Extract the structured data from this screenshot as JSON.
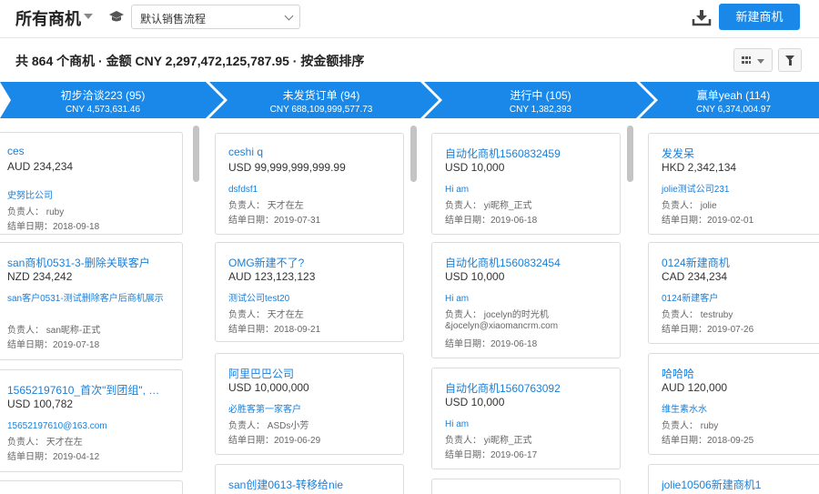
{
  "header": {
    "title": "所有商机",
    "pipeline": "默认销售流程",
    "new_button": "新建商机"
  },
  "summary": "共 864 个商机 · 金额 CNY 2,297,472,125,787.95 · 按金额排序",
  "stages": [
    {
      "name": "初步洽谈223 (95)",
      "amount": "CNY 4,573,631.46"
    },
    {
      "name": "未发货订单 (94)",
      "amount": "CNY 688,109,999,577.73"
    },
    {
      "name": "进行中 (105)",
      "amount": "CNY 1,382,393"
    },
    {
      "name": "赢单yeah (114)",
      "amount": "CNY 6,374,004.97"
    }
  ],
  "columns": [
    {
      "cards": [
        {
          "title": "ces",
          "amount": "AUD 234,234",
          "customer": "史努比公司",
          "owner": "负责人：  ruby",
          "date": "结单日期：2018-09-18"
        },
        {
          "title": "san商机0531-3-删除关联客户",
          "amount": "NZD 234,242",
          "customer": "san客户0531-测试删除客户后商机展示",
          "owner": "负责人：  san昵称-正式",
          "date": "结单日期：2019-07-18"
        },
        {
          "title": "15652197610_首次\"到团组\", …",
          "amount": "USD 100,782",
          "customer": "15652197610@163.com",
          "owner": "负责人：  天才在左",
          "date": "结单日期：2019-04-12"
        }
      ]
    },
    {
      "cards": [
        {
          "title": "ceshi q",
          "amount": "USD 99,999,999,999.99",
          "customer": "dsfdsf1",
          "owner": "负责人：  天才在左",
          "date": "结单日期：2019-07-31"
        },
        {
          "title": "OMG新建不了?",
          "amount": "AUD 123,123,123",
          "customer": "测试公司test20",
          "owner": "负责人：  天才在左",
          "date": "结单日期：2018-09-21"
        },
        {
          "title": "阿里巴巴公司",
          "amount": "USD 10,000,000",
          "customer": "必胜客第一家客户",
          "owner": "负责人：  ASDs小芳",
          "date": "结单日期：2019-06-29"
        },
        {
          "title": "san创建0613-转移给nie",
          "amount": "",
          "customer": "",
          "owner": "",
          "date": ""
        }
      ]
    },
    {
      "cards": [
        {
          "title": "自动化商机1560832459",
          "amount": "USD 10,000",
          "customer": "Hi am",
          "owner": "负责人：  yi昵称_正式",
          "date": "结单日期：2019-06-18"
        },
        {
          "title": "自动化商机1560832454",
          "amount": "USD 10,000",
          "customer": "Hi am",
          "owner": "负责人：  jocelyn的时光机",
          "owner2": "&jocelyn@xiaomancrm.com",
          "date": "结单日期：2019-06-18"
        },
        {
          "title": "自动化商机1560763092",
          "amount": "USD 10,000",
          "customer": "Hi am",
          "owner": "负责人：  yi昵称_正式",
          "date": "结单日期：2019-06-17"
        }
      ]
    },
    {
      "cards": [
        {
          "title": "发发呆",
          "amount": "HKD 2,342,134",
          "customer": "jolie测试公司231",
          "owner": "负责人：  jolie",
          "date": "结单日期：2019-02-01"
        },
        {
          "title": "0124新建商机",
          "amount": "CAD 234,234",
          "customer": "0124新建客户",
          "owner": "负责人：  testruby",
          "date": "结单日期：2019-07-26"
        },
        {
          "title": "哈哈哈",
          "amount": "AUD 120,000",
          "customer": "维生素水水",
          "owner": "负责人：  ruby",
          "date": "结单日期：2018-09-25"
        },
        {
          "title": "jolie10506新建商机1",
          "amount": "",
          "customer": "",
          "owner": "",
          "date": ""
        }
      ]
    }
  ],
  "colors": {
    "primary": "#1a88e8",
    "link": "#1a7fd8",
    "stage_bar": "#1a88e8"
  },
  "icons": [
    "caret-down-icon",
    "graduation-cap-icon",
    "chevron-down-icon",
    "import-icon",
    "grid-view-icon",
    "filter-icon"
  ]
}
